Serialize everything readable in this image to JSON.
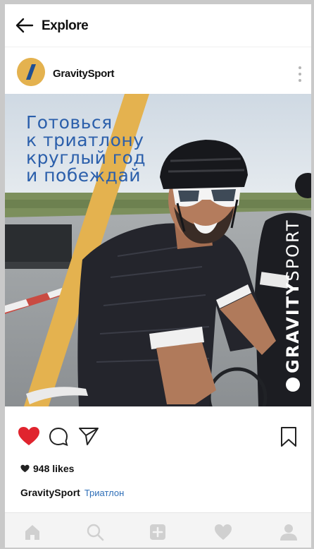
{
  "topbar": {
    "title": "Explore",
    "back_icon": "arrow-left-icon"
  },
  "post": {
    "username": "GravitySport",
    "more_icon": "more-vertical-icon",
    "image": {
      "headline_lines": [
        "Готовься",
        "к триатлону",
        "круглый год",
        "и побеждай"
      ],
      "brand_light": "GRAVITY",
      "brand_bold": "SPORT",
      "accent_color": "#e4b24f",
      "headline_color": "#2b5fab"
    },
    "actions": {
      "like_icon": "heart-filled-icon",
      "comment_icon": "comment-icon",
      "share_icon": "send-icon",
      "save_icon": "bookmark-icon",
      "like_color": "#e0242e"
    },
    "likes_text": "948 likes",
    "caption": {
      "user": "GravitySport",
      "tag": "Триатлон"
    }
  },
  "bottom_nav": {
    "items": [
      "home-icon",
      "search-icon",
      "add-post-icon",
      "activity-heart-icon",
      "profile-icon"
    ]
  }
}
